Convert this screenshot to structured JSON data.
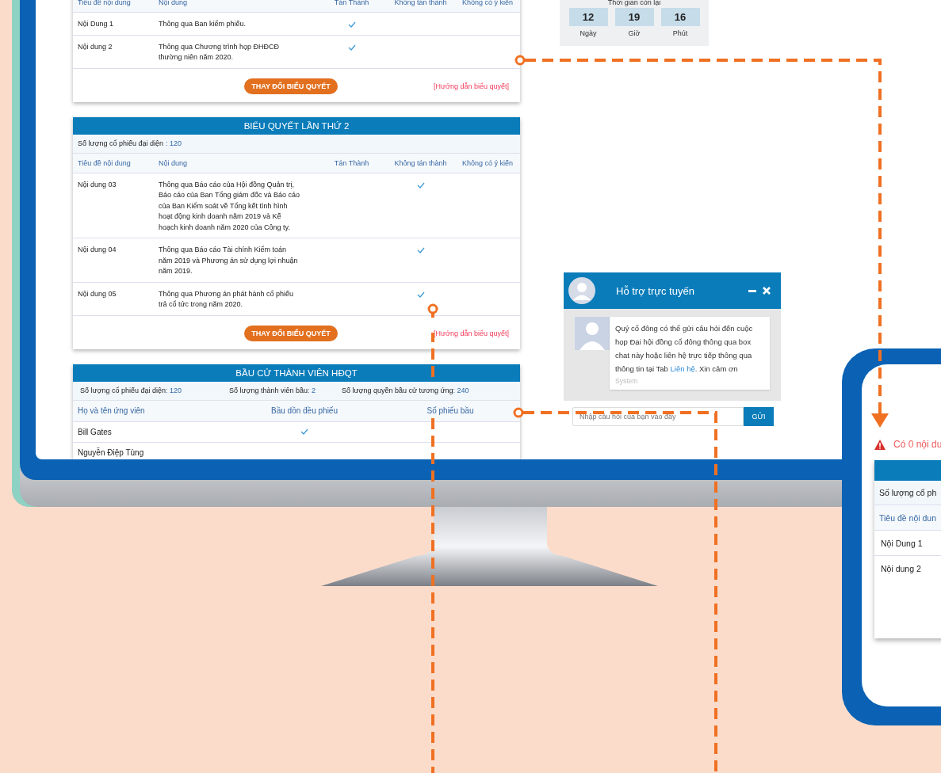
{
  "screen": {
    "vote_cards": [
      {
        "columns": [
          "Tiêu đề nội dung",
          "Nội dung",
          "Tán Thành",
          "Không tán thành",
          "Không có ý kiến"
        ],
        "rows": [
          {
            "title": "Nội Dung 1",
            "content": "Thông qua Ban kiểm phiếu.",
            "checks": [
              true,
              false,
              false
            ]
          },
          {
            "title": "Nội dung 2",
            "content": "Thông qua Chương trình họp ĐHĐCĐ thường niên năm 2020.",
            "checks": [
              true,
              false,
              false
            ]
          }
        ],
        "button": "THAY ĐỔI BIỂU QUYẾT",
        "guide_link": "[Hướng dẫn biểu quyết]"
      },
      {
        "title": "BIỂU QUYẾT LẦN THỨ 2",
        "shares": {
          "label": "Số lượng cổ phiếu đại diện",
          "value": ": 120"
        },
        "columns": [
          "Tiêu đề nội dung",
          "Nội dung",
          "Tán Thành",
          "Không tán thành",
          "Không có ý kiến"
        ],
        "rows": [
          {
            "title": "Nội dung 03",
            "content": "Thông qua Báo cáo của Hội đồng Quản trị, Báo cáo của Ban Tổng giám đốc và Báo cáo của Ban Kiểm soát về Tổng kết tình hình hoạt động kinh doanh năm 2019 và Kế hoạch kinh doanh năm 2020 của Công ty.",
            "checks": [
              false,
              true,
              false
            ]
          },
          {
            "title": "Nội dung 04",
            "content": "Thông qua Báo cáo Tài chính Kiểm toán năm 2019 và Phương án sử dụng lợi nhuận năm 2019.",
            "checks": [
              false,
              true,
              false
            ]
          },
          {
            "title": "Nội dung 05",
            "content": "Thông qua Phương án phát hành cổ phiếu trả cổ tức trong năm 2020.",
            "checks": [
              false,
              true,
              false
            ]
          }
        ],
        "button": "THAY ĐỔI BIỂU QUYẾT",
        "guide_link": "[Hướng dẫn biểu quyết]"
      }
    ],
    "election": {
      "title": "BẦU CỬ THÀNH VIÊN HĐQT",
      "stats": [
        {
          "label": "Số lượng cổ phiếu đại diện",
          "value": ": 120"
        },
        {
          "label": "Số lượng thành viên bầu",
          "value": ": 2"
        },
        {
          "label": "Số lượng quyền bầu cử tương ứng",
          "value": ": 240"
        }
      ],
      "columns": [
        "Họ và tên ứng viên",
        "Bầu dồn đều phiếu",
        "Số phiếu bầu"
      ],
      "candidates": [
        {
          "name": "Bill Gates",
          "cumulative": true
        },
        {
          "name": "Nguyễn Điệp Tùng",
          "cumulative": false
        }
      ]
    },
    "countdown": {
      "label": "Thời gian còn lại",
      "units": [
        {
          "value": "12",
          "label": "Ngày"
        },
        {
          "value": "19",
          "label": "Giờ"
        },
        {
          "value": "16",
          "label": "Phút"
        }
      ]
    },
    "chat": {
      "title": "Hỗ trợ trực tuyến",
      "message": {
        "before": "Quý cổ đông có thể gửi câu hỏi đến cuộc họp Đại hội đồng cổ đông thông qua box chat này hoặc liên hệ trực tiếp thông qua thông tin tại Tab",
        "link": "Liên hệ",
        "after": ". Xin cảm ơn",
        "sender": "System"
      },
      "placeholder": "Nhập câu hỏi của bạn vào đây",
      "send_button": "GỬI"
    }
  },
  "phone": {
    "warning": "Có 0 nội du",
    "shares_label": "Số lượng cổ ph",
    "column": "Tiêu đề nội dun",
    "rows": [
      "Nội Dung 1",
      "Nội dung 2"
    ]
  }
}
